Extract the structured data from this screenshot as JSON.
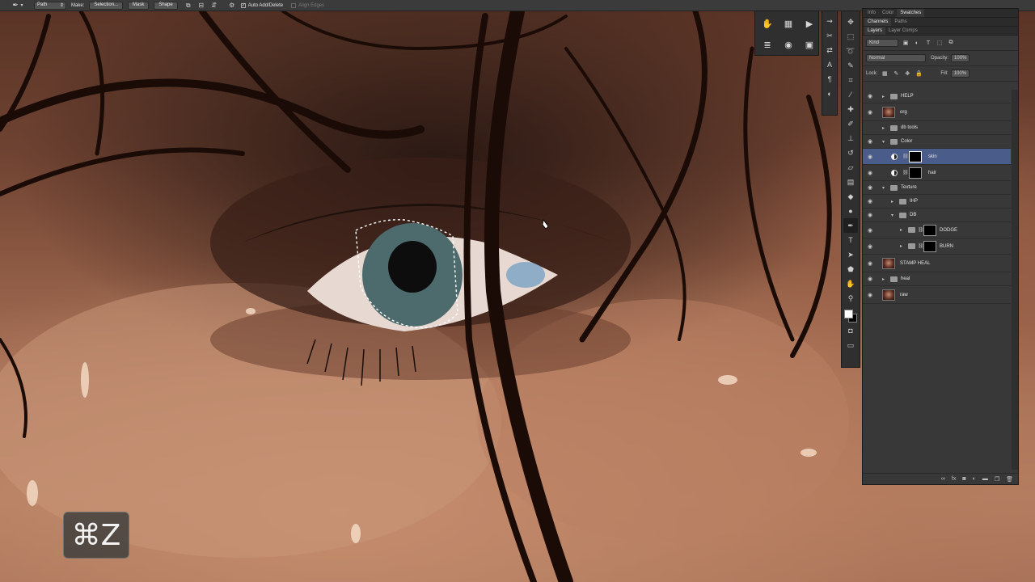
{
  "options_bar": {
    "tool_icon": "pen-tool-icon",
    "mode_select": "Path",
    "make_label": "Make:",
    "selection_button": "Selection...",
    "mask_button": "Mask",
    "shape_button": "Shape",
    "auto_add_delete_label": "Auto Add/Delete",
    "auto_add_delete_checked": true,
    "align_edges_label": "Align Edges"
  },
  "panel_tabs": {
    "top": [
      "Info",
      "Color",
      "Swatches"
    ],
    "top_active": "Swatches",
    "middle": [
      "Channels",
      "Paths"
    ],
    "middle_active": "Channels",
    "layers": [
      "Layers",
      "Layer Comps"
    ],
    "layers_active": "Layers"
  },
  "layers_panel": {
    "filter_kind": "Kind",
    "blend_mode": "Normal",
    "opacity_label": "Opacity:",
    "opacity_value": "100%",
    "lock_label": "Lock:",
    "fill_label": "Fill:",
    "fill_value": "100%",
    "layers": [
      {
        "name": "HELP",
        "type": "group",
        "level": 0,
        "collapsed": true,
        "visible": true
      },
      {
        "name": "org",
        "type": "pixel",
        "level": 0,
        "visible": true
      },
      {
        "name": "db tools",
        "type": "group",
        "level": 0,
        "collapsed": true,
        "visible": false
      },
      {
        "name": "Color",
        "type": "group",
        "level": 0,
        "collapsed": false,
        "visible": true
      },
      {
        "name": "skin",
        "type": "adjustment",
        "level": 1,
        "visible": true,
        "selected": true
      },
      {
        "name": "hair",
        "type": "adjustment",
        "level": 1,
        "visible": true
      },
      {
        "name": "Texture",
        "type": "group",
        "level": 0,
        "collapsed": false,
        "visible": true
      },
      {
        "name": "IHP",
        "type": "group",
        "level": 1,
        "collapsed": true,
        "visible": true
      },
      {
        "name": "DB",
        "type": "group",
        "level": 1,
        "collapsed": false,
        "visible": true
      },
      {
        "name": "DODGE",
        "type": "group-mask",
        "level": 2,
        "collapsed": true,
        "visible": true
      },
      {
        "name": "BURN",
        "type": "group-mask",
        "level": 2,
        "collapsed": true,
        "visible": true
      },
      {
        "name": "STAMP HEAL",
        "type": "pixel",
        "level": 0,
        "visible": true
      },
      {
        "name": "heal",
        "type": "group",
        "level": 0,
        "collapsed": true,
        "visible": true
      },
      {
        "name": "raw",
        "type": "pixel",
        "level": 0,
        "visible": true
      }
    ]
  },
  "shortcut_overlay": {
    "keys": "⌘Z"
  },
  "colors": {
    "selection_highlight": "#4a5d8a",
    "foreground": "#ffffff",
    "background": "#000000"
  }
}
